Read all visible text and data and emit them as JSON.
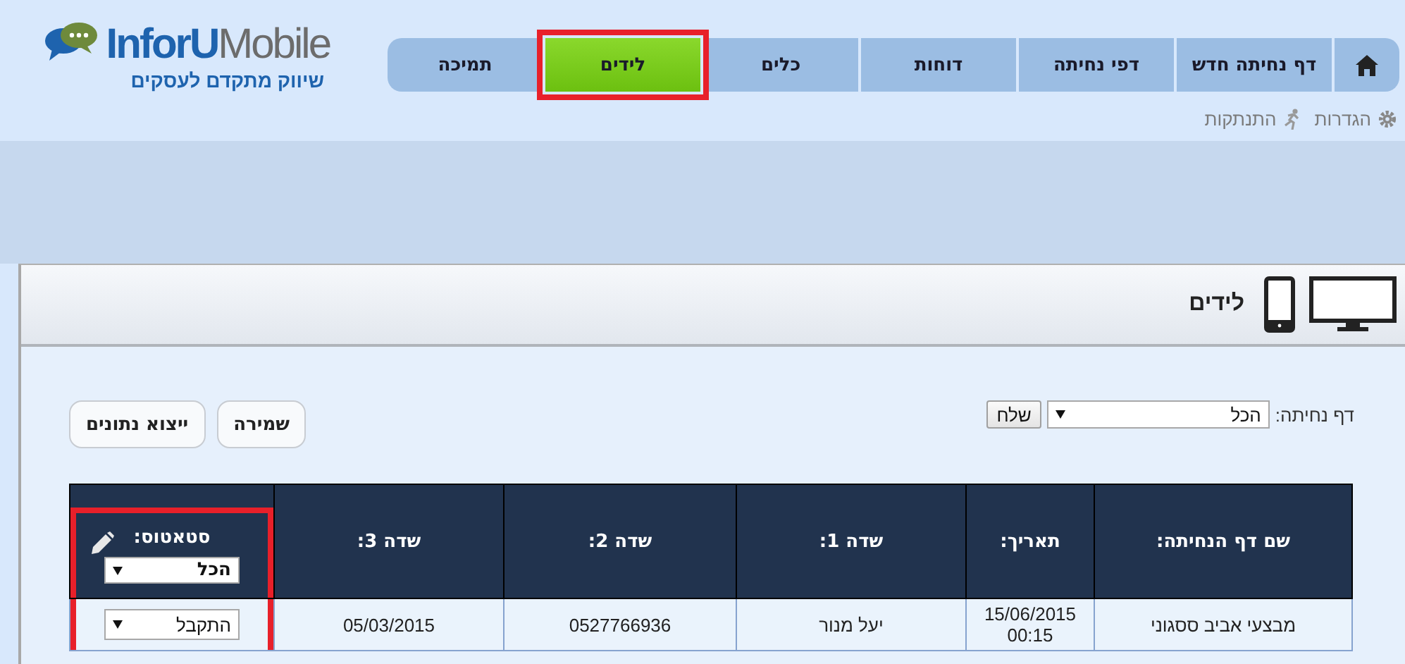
{
  "logo": {
    "brand_first": "InforU",
    "brand_second": "Mobile",
    "tagline": "שיווק מתקדם לעסקים"
  },
  "nav": {
    "tabs": [
      {
        "kind": "home",
        "selected": false,
        "highlighted": false
      },
      {
        "kind": "text",
        "label": "דף נחיתה חדש",
        "selected": false,
        "highlighted": false
      },
      {
        "kind": "text",
        "label": "דפי נחיתה",
        "selected": false,
        "highlighted": false
      },
      {
        "kind": "text",
        "label": "דוחות",
        "selected": false,
        "highlighted": false
      },
      {
        "kind": "text",
        "label": "כלים",
        "selected": false,
        "highlighted": false
      },
      {
        "kind": "text",
        "label": "לידים",
        "selected": true,
        "highlighted": true
      },
      {
        "kind": "text",
        "label": "תמיכה",
        "selected": false,
        "highlighted": false
      }
    ]
  },
  "user_links": [
    {
      "kind": "settings",
      "label": "הגדרות"
    },
    {
      "kind": "logout",
      "label": "התנתקות"
    }
  ],
  "panel": {
    "title": "לידים"
  },
  "filter": {
    "label": "דף נחיתה:",
    "value": "הכל",
    "submit": "שלח"
  },
  "actions": [
    "שמירה",
    "ייצוא נתונים"
  ],
  "table": {
    "columns": [
      {
        "kind": "text",
        "label": "שם דף הנחיתה:",
        "highlighted": false
      },
      {
        "kind": "text",
        "label": "תאריך:",
        "highlighted": false
      },
      {
        "kind": "text",
        "label": "שדה 1:",
        "highlighted": false
      },
      {
        "kind": "text",
        "label": "שדה 2:",
        "highlighted": false
      },
      {
        "kind": "text",
        "label": "שדה 3:",
        "highlighted": false
      },
      {
        "kind": "status",
        "label": "סטאטוס:",
        "filter_value": "הכל",
        "highlighted": true
      }
    ],
    "rows": [
      {
        "cells": [
          "מבצעי אביב ססגוני",
          "15/06/2015 00:15",
          "יעל מנור",
          "0527766936",
          "05/03/2015",
          "התקבל"
        ]
      }
    ]
  }
}
